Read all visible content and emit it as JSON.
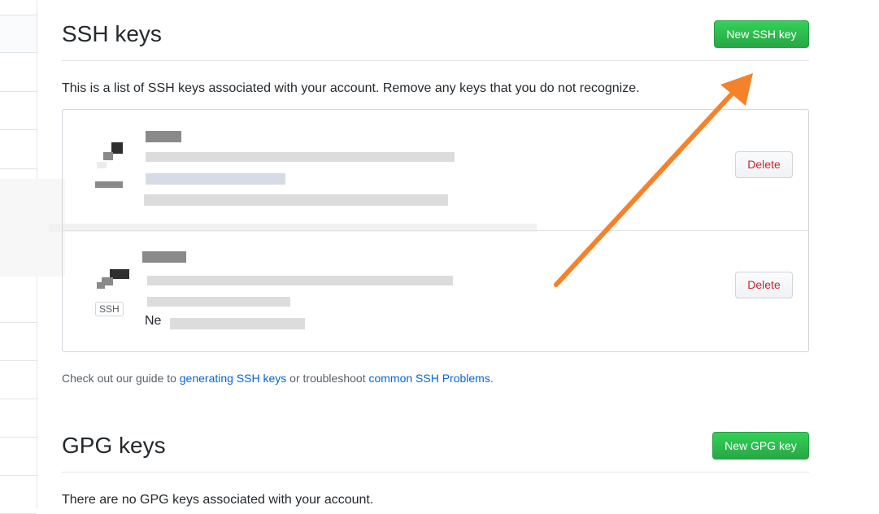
{
  "ssh": {
    "title": "SSH keys",
    "new_button": "New SSH key",
    "intro": "This is a list of SSH keys associated with your account. Remove any keys that you do not recognize.",
    "keys": [
      {
        "delete_label": "Delete"
      },
      {
        "type_badge": "SSH",
        "visible_text_fragment": "Ne",
        "delete_label": "Delete"
      }
    ],
    "help": {
      "prefix": "Check out our guide to ",
      "link1": "generating SSH keys",
      "middle": " or troubleshoot ",
      "link2": "common SSH Problems",
      "suffix": "."
    }
  },
  "gpg": {
    "title": "GPG keys",
    "new_button": "New GPG key",
    "empty_text": "There are no GPG keys associated with your account."
  },
  "annotation": {
    "arrow_color": "#f5822a"
  },
  "colors": {
    "primary_green": "#28a745",
    "danger_red": "#cb2431",
    "link_blue": "#0366d6"
  }
}
